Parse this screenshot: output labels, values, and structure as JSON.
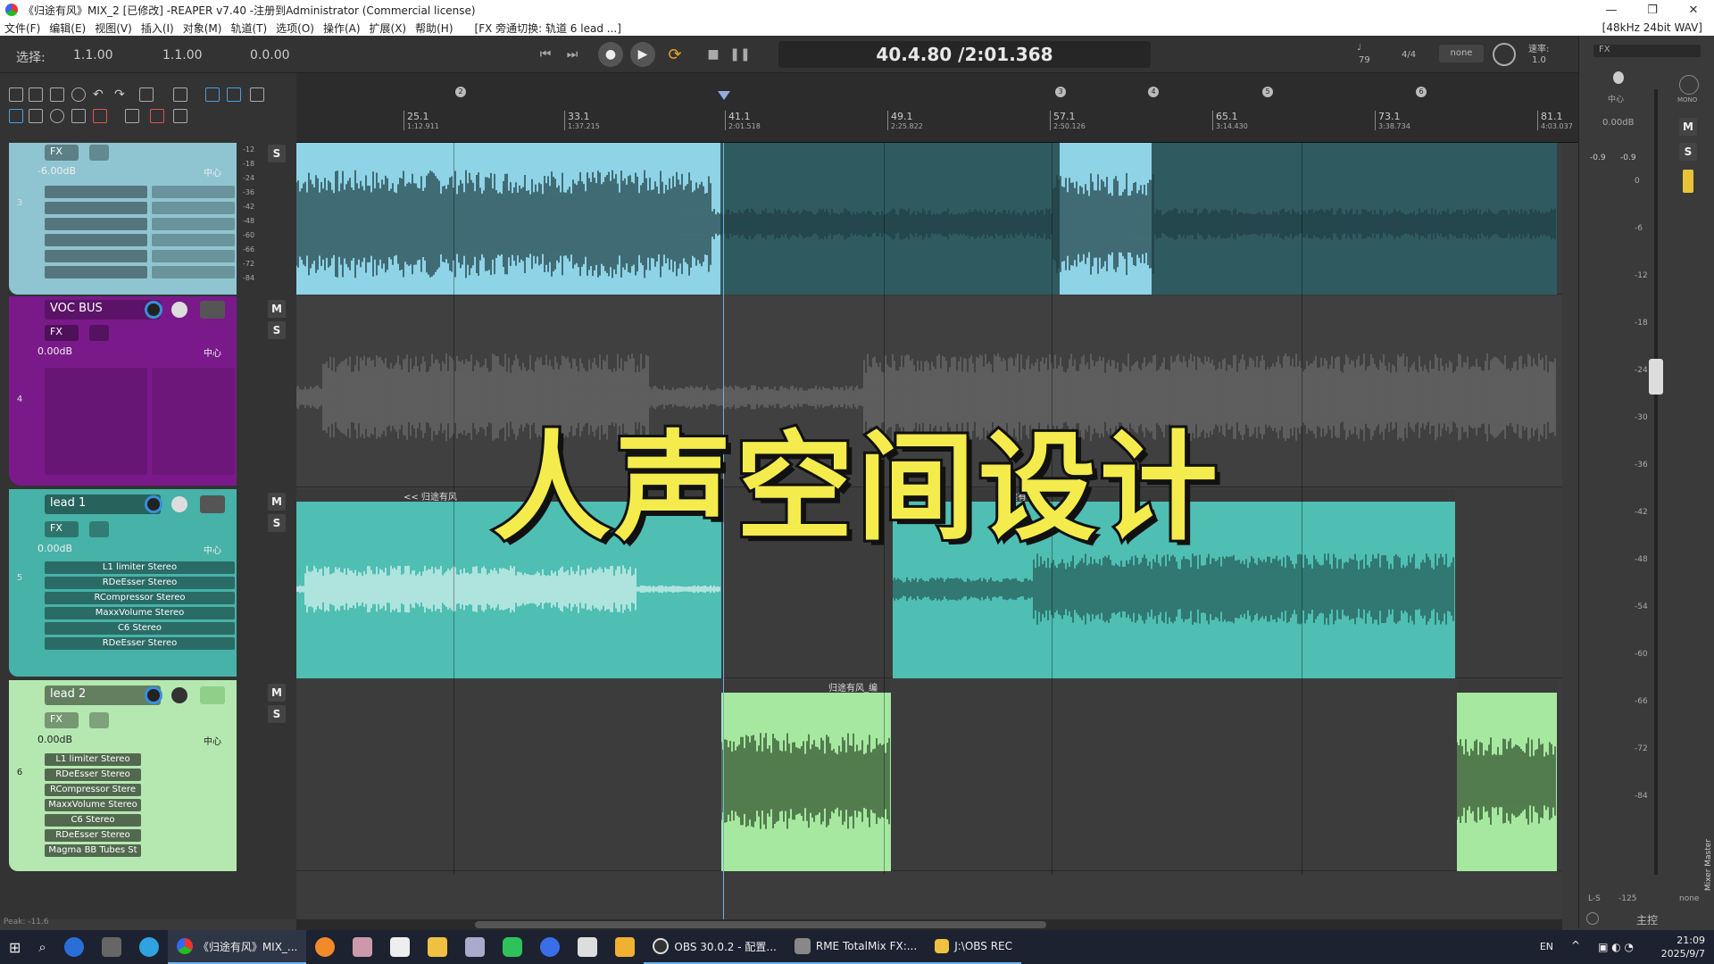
{
  "window": {
    "title": "《归途有风》MIX_2 [已修改] -REAPER v7.40 -注册到Administrator (Commercial license)",
    "controls": [
      "—",
      "❐",
      "✕"
    ]
  },
  "menu": {
    "items": [
      "文件(F)",
      "编辑(E)",
      "视图(V)",
      "插入(I)",
      "对象(M)",
      "轨道(T)",
      "选项(O)",
      "操作(A)",
      "扩展(X)",
      "帮助(H)"
    ],
    "status": "[FX 旁通切换: 轨道 6 lead ...]",
    "format": "[48kHz 24bit WAV]"
  },
  "transport": {
    "selection_label": "选择:",
    "sel_start": "1.1.00",
    "sel_end": "1.1.00",
    "sel_length": "0.0.00",
    "time": "40.4.80 /2:01.368",
    "bpm": "79",
    "timesig": "4/4",
    "grid": "none",
    "rate_label": "速率:",
    "rate": "1.0"
  },
  "ruler": {
    "labels": [
      {
        "bar": "25.1",
        "time": "1:12.911"
      },
      {
        "bar": "33.1",
        "time": "1:37.215"
      },
      {
        "bar": "41.1",
        "time": "2:01.518"
      },
      {
        "bar": "49.1",
        "time": "2:25.822"
      },
      {
        "bar": "57.1",
        "time": "2:50.126"
      },
      {
        "bar": "65.1",
        "time": "3:14.430"
      },
      {
        "bar": "73.1",
        "time": "3:38.734"
      },
      {
        "bar": "81.1",
        "time": "4:03.037"
      }
    ],
    "markers": [
      "2",
      "3",
      "4",
      "5",
      "6"
    ]
  },
  "tracks": [
    {
      "num": "3",
      "name": "",
      "vol": "-6.00dB",
      "pan": "中心",
      "color": "#8fc5d0",
      "fx": []
    },
    {
      "num": "4",
      "name": "VOC BUS",
      "vol": "0.00dB",
      "pan": "中心",
      "color": "#7a1a8a",
      "fx": []
    },
    {
      "num": "5",
      "name": "lead 1",
      "vol": "0.00dB",
      "pan": "中心",
      "color": "#47b2a8",
      "fx": [
        "L1 limiter Stereo",
        "RDeEsser Stereo",
        "RCompressor Stereo",
        "MaxxVolume Stereo",
        "C6 Stereo",
        "RDeEsser Stereo"
      ]
    },
    {
      "num": "6",
      "name": "lead 2",
      "vol": "0.00dB",
      "pan": "中心",
      "color": "#b5e8b0",
      "fx": [
        "L1 limiter Stereo",
        "RDeEsser Stereo",
        "RCompressor Stere",
        "MaxxVolume Stereo",
        "C6 Stereo",
        "RDeEsser Stereo",
        "Magma BB Tubes St"
      ]
    }
  ],
  "tcp_labels": {
    "fx": "FX",
    "m": "M",
    "s": "S"
  },
  "scale_marks": [
    "-12",
    "-18",
    "-24",
    "-30",
    "-36",
    "-42",
    "-48",
    "-54",
    "-60",
    "-66",
    "-72",
    "-84"
  ],
  "items": {
    "lead1_a": "<< 归途有风",
    "lead1_b": "归途有",
    "lead2_a": "归途有风_编"
  },
  "overlay_title": "人声空间设计",
  "status": "Peak: -11.6",
  "master": {
    "fx": "FX",
    "pan": "中心",
    "vol": "0.00dB",
    "peak_l": "-0.9",
    "peak_r": "-0.9",
    "mono": "MONO",
    "scale": [
      "0",
      "-6",
      "-12",
      "-18",
      "-24",
      "-30",
      "-36",
      "-42",
      "-48",
      "-54",
      "-60",
      "-66",
      "-72",
      "-84"
    ],
    "ls": "L-S",
    "ls_val": "-125",
    "bottom_label": "主控",
    "none": "none",
    "side_label": "Mixer Master"
  },
  "taskbar": {
    "apps": [
      "《归途有风》MIX_...",
      "OBS 30.0.2 - 配置...",
      "RME TotalMix FX:...",
      "J:\\OBS REC"
    ],
    "lang": "EN",
    "clock": "21:09",
    "date": "2025/9/7"
  },
  "colors": {
    "accent": "#3a8edc",
    "title_yellow": "#f4ec4c"
  }
}
